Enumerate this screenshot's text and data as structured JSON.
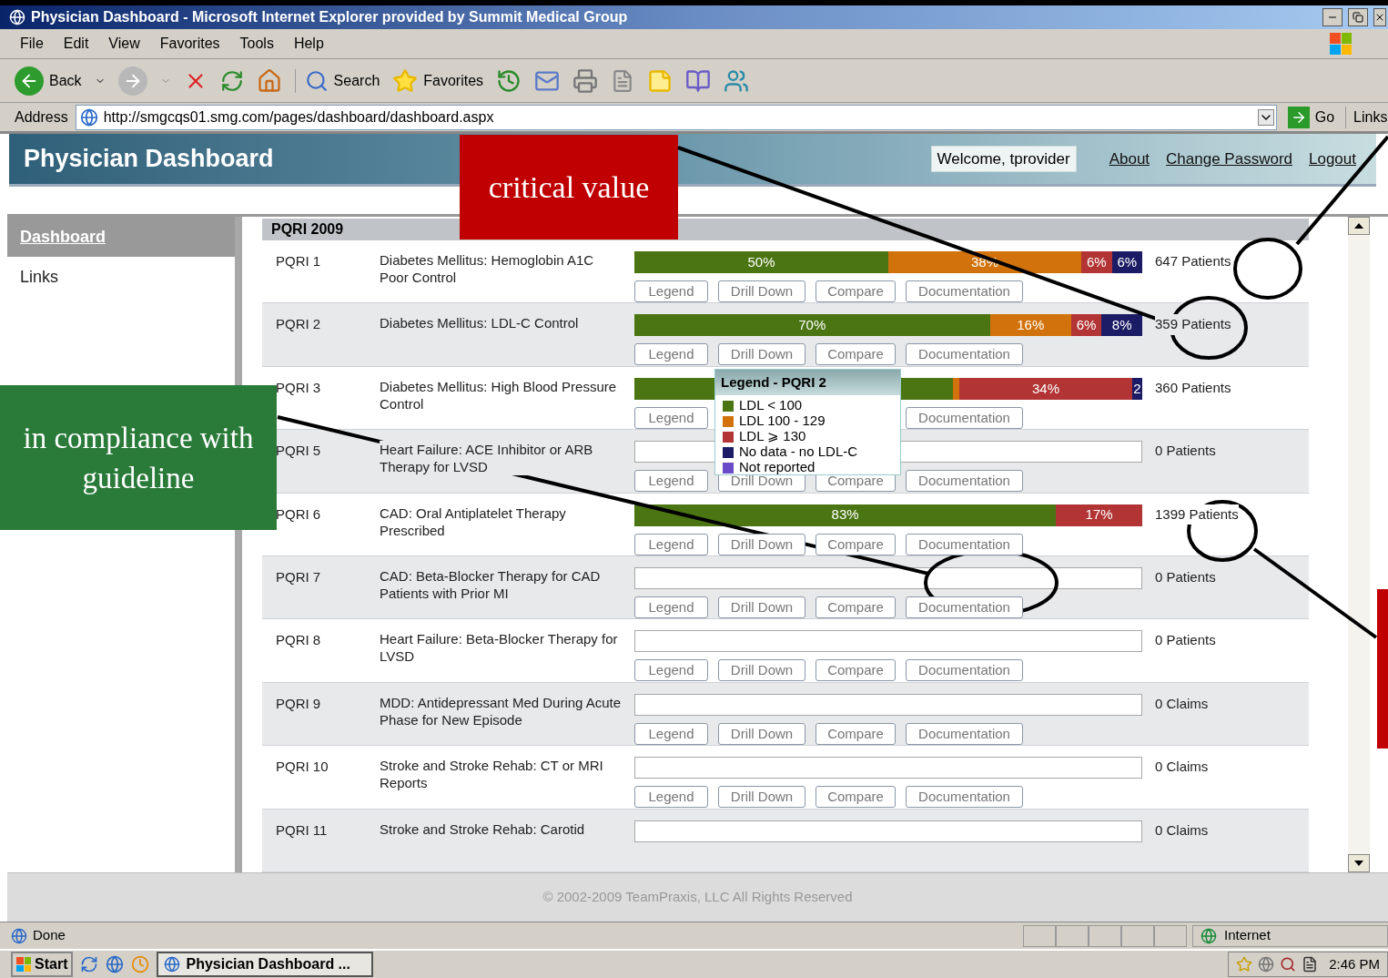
{
  "window": {
    "title": "Physician Dashboard - Microsoft Internet Explorer provided by Summit Medical Group"
  },
  "menu": [
    "File",
    "Edit",
    "View",
    "Favorites",
    "Tools",
    "Help"
  ],
  "toolbar": {
    "back": "Back",
    "search": "Search",
    "favorites": "Favorites"
  },
  "address": {
    "label": "Address",
    "url": "http://smgcqs01.smg.com/pages/dashboard/dashboard.aspx",
    "go": "Go",
    "links": "Links"
  },
  "page": {
    "title": "Physician Dashboard",
    "welcome": "Welcome, tprovider",
    "links": [
      "About",
      "Change Password",
      "Logout"
    ]
  },
  "sidebar": {
    "items": [
      {
        "label": "Dashboard",
        "selected": true
      },
      {
        "label": "Links",
        "selected": false
      }
    ]
  },
  "section": {
    "title": "PQRI 2009"
  },
  "measures": [
    {
      "id": "PQRI 1",
      "name": "Diabetes Mellitus: Hemoglobin A1C Poor Control",
      "count": "647 Patients",
      "segments": [
        {
          "label": "50%",
          "color": "#4a7512"
        },
        {
          "label": "38%",
          "color": "#d2720c"
        },
        {
          "label": "6%",
          "color": "#b23434"
        },
        {
          "label": "6%",
          "color": "#1c1c66"
        }
      ],
      "buttons": [
        {
          "kind": "legend",
          "label": "Legend"
        },
        {
          "kind": "drill",
          "label": "Drill Down"
        },
        {
          "kind": "compare",
          "label": "Compare"
        },
        {
          "kind": "doc",
          "label": "Documentation"
        }
      ]
    },
    {
      "id": "PQRI 2",
      "name": "Diabetes Mellitus: LDL-C Control",
      "count": "359 Patients",
      "segments": [
        {
          "label": "70%",
          "color": "#4a7512"
        },
        {
          "label": "16%",
          "color": "#d2720c"
        },
        {
          "label": "6%",
          "color": "#b23434"
        },
        {
          "label": "8%",
          "color": "#1c1c66"
        }
      ],
      "buttons": [
        {
          "kind": "legend",
          "label": "Legend"
        },
        {
          "kind": "drill",
          "label": "Drill Down"
        },
        {
          "kind": "compare",
          "label": "Compare"
        },
        {
          "kind": "doc",
          "label": "Documentation"
        }
      ]
    },
    {
      "id": "PQRI 3",
      "name": "Diabetes Mellitus: High Blood Pressure Control",
      "count": "360 Patients",
      "segments": [
        {
          "color": "#4a7512"
        },
        {
          "color": "#d2720c"
        },
        {
          "label": "34%",
          "color": "#b23434"
        },
        {
          "label": "2",
          "color": "#1c1c66"
        }
      ],
      "buttons": [
        {
          "kind": "legend",
          "label": "Legend"
        },
        {
          "kind": "doc",
          "label": "Documentation"
        }
      ]
    },
    {
      "id": "PQRI 5",
      "name": "Heart Failure: ACE Inhibitor or ARB Therapy for LVSD",
      "count": "0 Patients",
      "buttons": [
        {
          "kind": "legend",
          "label": "Legend"
        },
        {
          "kind": "drill",
          "label": "Drill Down"
        },
        {
          "kind": "compare",
          "label": "Compare"
        },
        {
          "kind": "doc",
          "label": "Documentation"
        }
      ]
    },
    {
      "id": "PQRI 6",
      "name": "CAD: Oral Antiplatelet Therapy Prescribed",
      "count": "1399 Patients",
      "segments": [
        {
          "label": "83%",
          "color": "#4a7512"
        },
        {
          "label": "17%",
          "color": "#b23434"
        }
      ],
      "buttons": [
        {
          "kind": "legend",
          "label": "Legend"
        },
        {
          "kind": "drill",
          "label": "Drill Down"
        },
        {
          "kind": "compare",
          "label": "Compare"
        },
        {
          "kind": "doc",
          "label": "Documentation"
        }
      ]
    },
    {
      "id": "PQRI 7",
      "name": "CAD: Beta-Blocker Therapy for CAD Patients with Prior MI",
      "count": "0 Patients",
      "buttons": [
        {
          "kind": "legend",
          "label": "Legend"
        },
        {
          "kind": "drill",
          "label": "Drill Down"
        },
        {
          "kind": "compare",
          "label": "Compare"
        },
        {
          "kind": "doc",
          "label": "Documentation"
        }
      ]
    },
    {
      "id": "PQRI 8",
      "name": "Heart Failure: Beta-Blocker Therapy for LVSD",
      "count": "0 Patients",
      "buttons": [
        {
          "kind": "legend",
          "label": "Legend"
        },
        {
          "kind": "drill",
          "label": "Drill Down"
        },
        {
          "kind": "compare",
          "label": "Compare"
        },
        {
          "kind": "doc",
          "label": "Documentation"
        }
      ]
    },
    {
      "id": "PQRI 9",
      "name": "MDD: Antidepressant Med During Acute Phase for New Episode",
      "count": "0 Claims",
      "buttons": [
        {
          "kind": "legend",
          "label": "Legend"
        },
        {
          "kind": "drill",
          "label": "Drill Down"
        },
        {
          "kind": "compare",
          "label": "Compare"
        },
        {
          "kind": "doc",
          "label": "Documentation"
        }
      ]
    },
    {
      "id": "PQRI 10",
      "name": "Stroke and Stroke Rehab: CT or MRI Reports",
      "count": "0 Claims",
      "buttons": [
        {
          "kind": "legend",
          "label": "Legend"
        },
        {
          "kind": "drill",
          "label": "Drill Down"
        },
        {
          "kind": "compare",
          "label": "Compare"
        },
        {
          "kind": "doc",
          "label": "Documentation"
        }
      ]
    },
    {
      "id": "PQRI 11",
      "name": "Stroke and Stroke Rehab: Carotid",
      "count": "0 Claims"
    }
  ],
  "legend_popup": {
    "title": "Legend - PQRI 2",
    "items": [
      {
        "label": "LDL < 100",
        "color": "#4a7512"
      },
      {
        "label": "LDL 100 - 129",
        "color": "#d2720c"
      },
      {
        "label": "LDL ⩾ 130",
        "color": "#b23434"
      },
      {
        "label": "No data - no LDL-C",
        "color": "#1c1c66"
      },
      {
        "label": "Not reported",
        "color": "#6a4cc8"
      }
    ]
  },
  "footer": "© 2002-2009 TeamPraxis, LLC All Rights Reserved",
  "status_bar": {
    "text": "Done",
    "zone": "Internet"
  },
  "taskbar": {
    "start": "Start",
    "task": "Physician Dashboard ...",
    "time": "2:46 PM"
  },
  "annotations": [
    {
      "text": "critical value",
      "color": "#c00000"
    },
    {
      "text": "in compliance with guideline",
      "color": "#2a7a3a"
    }
  ]
}
